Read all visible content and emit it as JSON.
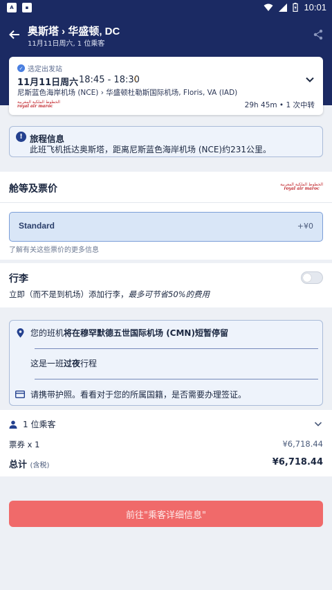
{
  "status_bar": {
    "time": "10:01"
  },
  "app_bar": {
    "title": "奥斯塔 › 华盛顿, DC",
    "subtitle": "11月11日周六, 1 位乘客"
  },
  "flight": {
    "chip": "选定出发站",
    "date": "11月11日周六",
    "times": "18:45 - 18:30",
    "route": "尼斯蓝色海岸机场 (NCE) › 华盛顿杜勒斯国际机场, Floris, VA (IAD)",
    "duration": "29h 45m • 1 次中转",
    "airline_logo_ar": "الخطوط الملكية المغربية",
    "airline_logo_en": "royal air maroc"
  },
  "itinerary_info": {
    "title": "旅程信息",
    "text": "此班飞机抵达奥斯塔，距离尼斯蓝色海岸机场 (NCE)约231公里。"
  },
  "fare": {
    "header": "舱等及票价",
    "option_name": "Standard",
    "option_price": "+¥0",
    "learn_more": "了解有关这些票价的更多信息"
  },
  "baggage": {
    "header": "行李",
    "text_prefix": "立即（而不是到机场）添加行李，",
    "text_emph": "最多可节省50%的费用"
  },
  "notices": {
    "stopover_prefix": "您的班机",
    "stopover_bold": "将在穆罕默德五世国际机场 (CMN)短暂停留",
    "overnight_prefix": "这是一班",
    "overnight_bold": "过夜",
    "overnight_suffix": "行程",
    "passport": "请携带护照。看看对于您的所属国籍，是否需要办理签证。"
  },
  "passengers": {
    "count_label": "1 位乘客",
    "ticket_label": "票券 x 1",
    "ticket_value": "¥6,718.44",
    "total_label": "总计",
    "total_tax": "(含税)",
    "total_value": "¥6,718.44"
  },
  "cta": {
    "label": "前往\"乘客详细信息\""
  },
  "colors": {
    "navy": "#1b2a63",
    "cta": "#f06a6a",
    "accent_blue": "#24418f"
  }
}
